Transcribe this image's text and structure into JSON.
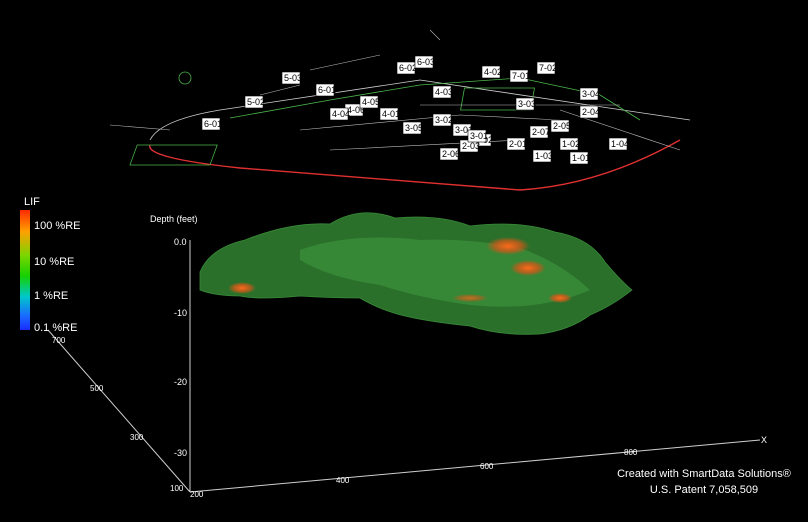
{
  "legend": {
    "title": "LIF",
    "labels": [
      "100 %RE",
      "10 %RE",
      "1 %RE",
      "0.1 %RE"
    ]
  },
  "axes": {
    "depth_title": "Depth (feet)",
    "depth_ticks": [
      "0.0",
      "-10",
      "-20",
      "-30"
    ],
    "x_ticks": [
      "200",
      "400",
      "600",
      "800"
    ],
    "x_letter": "X",
    "y_ticks": [
      "100",
      "300",
      "500",
      "700"
    ]
  },
  "wells": [
    "6-01",
    "5-02",
    "5-03",
    "6-02",
    "6-03",
    "6-01",
    "4-06",
    "4-05",
    "4-04",
    "4-01",
    "3-05",
    "4-03",
    "4-02",
    "3-01",
    "3-02",
    "3-02",
    "2-06",
    "2-03",
    "2-01",
    "2-07",
    "1-03",
    "1-01",
    "1-02",
    "2-05",
    "3-03",
    "3-04",
    "2-04",
    "1-04",
    "3-01",
    "7-01",
    "7-02"
  ],
  "credit": {
    "line1": "Created with SmartData Solutions®",
    "line2": "U.S. Patent 7,058,509"
  },
  "colors": {
    "background": "#000000",
    "plume": "#2f7d2f",
    "hotspot": "#d8641a",
    "site_lines": "#4cb84c",
    "road": "#e03030",
    "axis": "#cccccc"
  }
}
